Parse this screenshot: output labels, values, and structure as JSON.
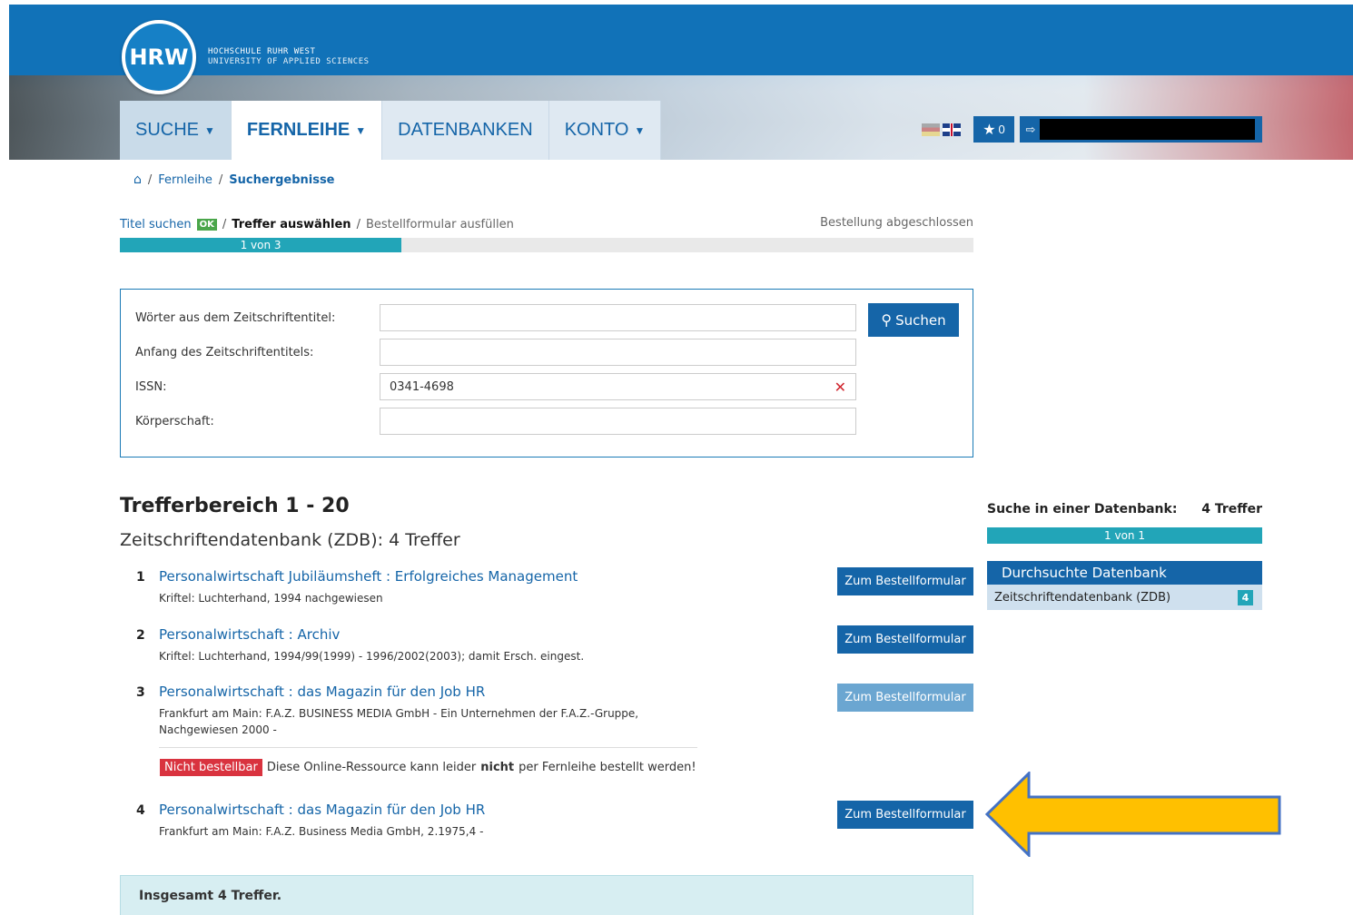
{
  "header": {
    "logo_text": "HRW",
    "university_line1": "HOCHSCHULE RUHR WEST",
    "university_line2": "UNIVERSITY OF APPLIED SCIENCES",
    "nav": [
      {
        "label": "SUCHE",
        "has_dropdown": true
      },
      {
        "label": "FERNLEIHE",
        "has_dropdown": true,
        "active": true
      },
      {
        "label": "DATENBANKEN",
        "has_dropdown": false
      },
      {
        "label": "KONTO",
        "has_dropdown": true
      }
    ],
    "favorites_count": "0",
    "icons": {
      "favorites": "star-icon",
      "logout": "logout-icon",
      "german": "flag-de-icon",
      "english": "flag-uk-icon"
    }
  },
  "breadcrumb": {
    "items": [
      "Fernleihe",
      "Suchergebnisse"
    ]
  },
  "steps": {
    "step1": "Titel suchen",
    "step1_badge": "OK",
    "step2": "Treffer auswählen",
    "step3": "Bestellformular ausfüllen",
    "step4": "Bestellung abgeschlossen",
    "progress_label": "1 von 3",
    "progress_fraction": 0.33
  },
  "search_form": {
    "fields": [
      {
        "label": "Wörter aus dem Zeitschriftentitel:",
        "value": ""
      },
      {
        "label": "Anfang des Zeitschriftentitels:",
        "value": ""
      },
      {
        "label": "ISSN:",
        "value": "0341-4698"
      },
      {
        "label": "Körperschaft:",
        "value": ""
      }
    ],
    "button_label": "Suchen"
  },
  "results": {
    "range_title": "Trefferbereich 1 - 20",
    "source_title": "Zeitschriftendatenbank (ZDB): 4 Treffer",
    "order_button_label": "Zum Bestellformular",
    "items": [
      {
        "num": "1",
        "title": "Personalwirtschaft Jubiläumsheft : Erfolgreiches Management",
        "meta": "Kriftel: Luchterhand, 1994 nachgewiesen",
        "orderable": true
      },
      {
        "num": "2",
        "title": "Personalwirtschaft : Archiv",
        "meta": "Kriftel: Luchterhand, 1994/99(1999) - 1996/2002(2003); damit Ersch. eingest.",
        "orderable": true
      },
      {
        "num": "3",
        "title": "Personalwirtschaft : das Magazin für den Job HR",
        "meta": "Frankfurt am Main: F.A.Z. BUSINESS MEDIA GmbH - Ein Unternehmen der F.A.Z.-Gruppe, Nachgewiesen 2000 -",
        "orderable": false
      },
      {
        "num": "4",
        "title": "Personalwirtschaft : das Magazin für den Job HR",
        "meta": "Frankfurt am Main: F.A.Z. Business Media GmbH, 2.1975,4 -",
        "orderable": true
      }
    ],
    "not_orderable": {
      "badge": "Nicht bestellbar",
      "text_before": "Diese Online-Ressource kann leider",
      "text_bold": "nicht",
      "text_after": "per Fernleihe bestellt werden!"
    },
    "total": "Insgesamt 4 Treffer."
  },
  "sidebar": {
    "heading": "Suche in einer Datenbank:",
    "hits": "4 Treffer",
    "progress_label": "1 von 1",
    "panel_title": "Durchsuchte Datenbank",
    "db_name": "Zeitschriftendatenbank (ZDB)",
    "db_count": "4"
  },
  "annotation": {
    "arrow_color": "#ffc000",
    "arrow_outline": "#4472c4"
  }
}
